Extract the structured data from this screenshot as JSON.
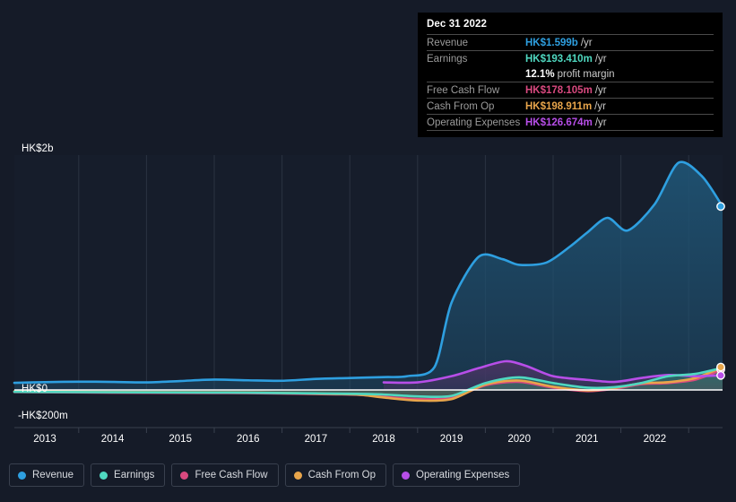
{
  "chart_data": {
    "type": "area",
    "title": "",
    "xlabel": "",
    "ylabel": "",
    "currency": "HK$",
    "grid": true,
    "legend_position": "bottom-left",
    "x_tick_labels": [
      "2013",
      "2014",
      "2015",
      "2016",
      "2017",
      "2018",
      "2019",
      "2020",
      "2021",
      "2022"
    ],
    "y_tick_labels": [
      "HK$2b",
      "HK$0",
      "-HK$200m"
    ],
    "ylim": [
      -200000000,
      2200000000
    ],
    "zero_line_value": 0,
    "gridline_values": [
      2000000000,
      1600000000,
      1200000000,
      800000000,
      400000000,
      0
    ],
    "series": [
      {
        "name": "Revenue",
        "color": "#2e9fe0",
        "fill": "#1f5272",
        "x": [
          2012.55,
          2013,
          2013.5,
          2014,
          2014.5,
          2015,
          2015.5,
          2016,
          2016.5,
          2017,
          2017.5,
          2018,
          2018.35,
          2018.75,
          2019,
          2019.4,
          2019.75,
          2020,
          2020.4,
          2020.75,
          2021,
          2021.3,
          2021.6,
          2022,
          2022.35,
          2022.7,
          2023.0
        ],
        "values": [
          62,
          68,
          72,
          70,
          66,
          78,
          90,
          84,
          80,
          96,
          104,
          112,
          120,
          200,
          760,
          1160,
          1140,
          1090,
          1110,
          1250,
          1370,
          1500,
          1390,
          1620,
          1980,
          1860,
          1599
        ],
        "value_unit": "HK$m",
        "end_value_label": "HK$1.599b"
      },
      {
        "name": "Earnings",
        "color": "#4fd8c0",
        "fill": "#2b6f6a",
        "x": [
          2012.55,
          2013,
          2014,
          2015,
          2016,
          2017,
          2017.6,
          2018,
          2018.5,
          2019,
          2019.5,
          2020,
          2020.5,
          2021,
          2021.4,
          2021.8,
          2022.2,
          2022.6,
          2023.0
        ],
        "values": [
          -16,
          -18,
          -20,
          -22,
          -24,
          -30,
          -34,
          -40,
          -56,
          -52,
          60,
          110,
          60,
          20,
          24,
          60,
          120,
          140,
          193.41
        ],
        "value_unit": "HK$m",
        "end_value_label": "HK$193.410m"
      },
      {
        "name": "Free Cash Flow",
        "color": "#d9497f",
        "fill": "#6a3952",
        "x": [
          2012.55,
          2013,
          2014,
          2015,
          2016,
          2017,
          2017.6,
          2018,
          2018.5,
          2019,
          2019.5,
          2020,
          2020.5,
          2021,
          2021.4,
          2021.8,
          2022.2,
          2022.6,
          2023.0
        ],
        "values": [
          -18,
          -20,
          -24,
          -26,
          -28,
          -36,
          -42,
          -60,
          -80,
          -70,
          40,
          70,
          20,
          -10,
          10,
          50,
          60,
          90,
          178.105
        ],
        "value_unit": "HK$m",
        "end_value_label": "HK$178.105m"
      },
      {
        "name": "Cash From Op",
        "color": "#e8a54b",
        "fill": "#7a5a45",
        "x": [
          2012.55,
          2013,
          2014,
          2015,
          2016,
          2017,
          2017.6,
          2018,
          2018.5,
          2019,
          2019.5,
          2020,
          2020.5,
          2021,
          2021.4,
          2021.8,
          2022.2,
          2022.6,
          2023.0
        ],
        "values": [
          -12,
          -14,
          -18,
          -20,
          -22,
          -32,
          -40,
          -66,
          -92,
          -80,
          48,
          82,
          28,
          -4,
          16,
          58,
          68,
          104,
          198.911
        ],
        "value_unit": "HK$m",
        "end_value_label": "HK$198.911m"
      },
      {
        "name": "Operating Expenses",
        "color": "#b74ee8",
        "fill": "#4a3463",
        "x": [
          2018.0,
          2018.5,
          2019,
          2019.4,
          2019.8,
          2020.1,
          2020.5,
          2021,
          2021.4,
          2021.8,
          2022.2,
          2022.6,
          2023.0
        ],
        "values": [
          66,
          66,
          120,
          190,
          250,
          210,
          120,
          88,
          70,
          104,
          130,
          120,
          126.674
        ],
        "value_unit": "HK$m",
        "end_value_label": "HK$126.674m"
      }
    ]
  },
  "tooltip": {
    "date": "Dec 31 2022",
    "rows": [
      {
        "name": "Revenue",
        "value": "HK$1.599b",
        "unit": "/yr",
        "color": "#2e9fe0"
      },
      {
        "name": "Earnings",
        "value": "HK$193.410m",
        "unit": "/yr",
        "color": "#4fd8c0"
      },
      {
        "name": "",
        "value": "12.1%",
        "unit": "profit margin",
        "color": "#ffffff"
      },
      {
        "name": "Free Cash Flow",
        "value": "HK$178.105m",
        "unit": "/yr",
        "color": "#d9497f"
      },
      {
        "name": "Cash From Op",
        "value": "HK$198.911m",
        "unit": "/yr",
        "color": "#e8a54b"
      },
      {
        "name": "Operating Expenses",
        "value": "HK$126.674m",
        "unit": "/yr",
        "color": "#b74ee8"
      }
    ]
  },
  "legend": {
    "items": [
      {
        "label": "Revenue",
        "color": "#2e9fe0"
      },
      {
        "label": "Earnings",
        "color": "#4fd8c0"
      },
      {
        "label": "Free Cash Flow",
        "color": "#d9497f"
      },
      {
        "label": "Cash From Op",
        "color": "#e8a54b"
      },
      {
        "label": "Operating Expenses",
        "color": "#b74ee8"
      }
    ]
  },
  "y_axis": {
    "top_label": "HK$2b",
    "zero_label": "HK$0",
    "bottom_label": "-HK$200m"
  },
  "colors": {
    "background": "#151b28",
    "plot_background": "#161d2b",
    "grid": "#2b3342",
    "zero_line": "#ffffff",
    "tooltip_background": "#000000"
  }
}
